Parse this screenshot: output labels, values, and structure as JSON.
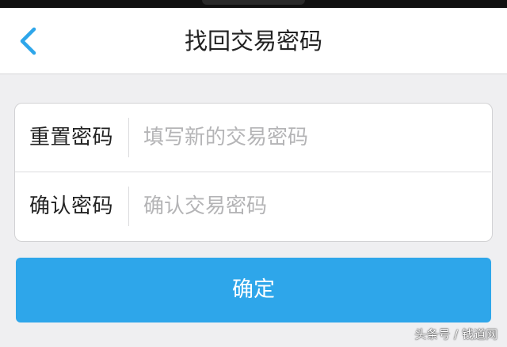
{
  "theme": {
    "accent": "#2ea6ea",
    "page_background": "#efeff1",
    "card_background": "#ffffff",
    "text_color": "#222222",
    "placeholder_color": "#b4b4b6"
  },
  "header": {
    "back_icon": "chevron-left-icon",
    "title": "找回交易密码"
  },
  "form": {
    "rows": [
      {
        "label": "重置密码",
        "value": "",
        "placeholder": "填写新的交易密码"
      },
      {
        "label": "确认密码",
        "value": "",
        "placeholder": "确认交易密码"
      }
    ]
  },
  "actions": {
    "confirm_label": "确定"
  },
  "watermark": {
    "text": "头条号 / 钱道网"
  }
}
